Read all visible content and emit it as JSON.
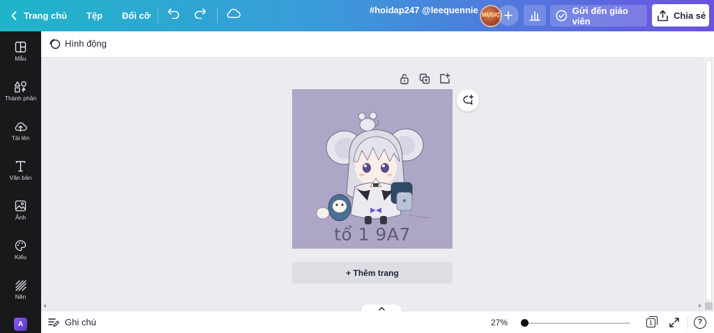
{
  "topbar": {
    "back_label": "Trang chủ",
    "file_label": "Tệp",
    "resize_label": "Đổi cỡ",
    "title": "#hoidap247 @leequennie",
    "avatar_text": "MUSIC",
    "send_label": "Gửi đến giáo viên",
    "share_label": "Chia sẻ"
  },
  "sidebar": {
    "items": [
      {
        "label": "Mẫu",
        "icon": "template-icon"
      },
      {
        "label": "Thành phần",
        "icon": "elements-icon"
      },
      {
        "label": "Tải lên",
        "icon": "upload-icon"
      },
      {
        "label": "Văn bản",
        "icon": "text-icon"
      },
      {
        "label": "Ảnh",
        "icon": "photo-icon"
      },
      {
        "label": "Kiểu",
        "icon": "palette-icon"
      },
      {
        "label": "Nền",
        "icon": "background-icon"
      }
    ],
    "apps_label": "A"
  },
  "subbar": {
    "animate_label": "Hình động"
  },
  "design": {
    "caption": "tổ 1 9A7",
    "background": "#aea6c6"
  },
  "canvas": {
    "add_page_label": "+ Thêm trang"
  },
  "bottombar": {
    "notes_label": "Ghi chú",
    "zoom": "27%",
    "page_count": "1",
    "help_label": "?"
  },
  "colors": {
    "sidebar_bg": "#18191b",
    "canvas_bg": "#ebecf0",
    "gradient_start": "#1fb5c9",
    "gradient_end": "#6a52e0"
  }
}
